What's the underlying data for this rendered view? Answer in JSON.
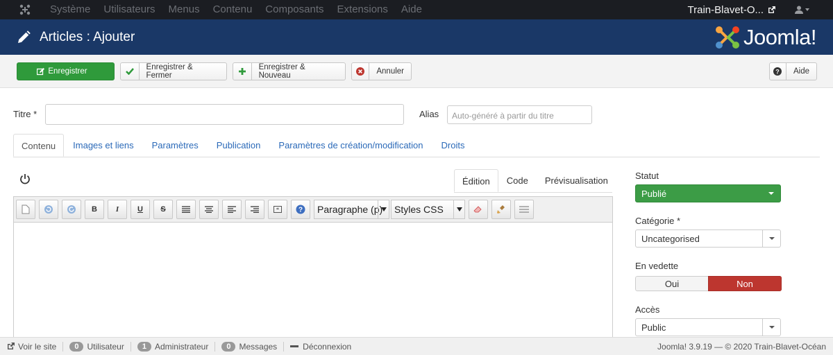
{
  "topnav": {
    "menu": [
      "Système",
      "Utilisateurs",
      "Menus",
      "Contenu",
      "Composants",
      "Extensions",
      "Aide"
    ],
    "site_name": "Train-Blavet-O...",
    "icons": [
      "joomla-icon",
      "external-link-icon",
      "user-icon"
    ]
  },
  "header": {
    "title": "Articles : Ajouter",
    "brand": "Joomla!"
  },
  "toolbar": {
    "save": "Enregistrer",
    "save_close": "Enregistrer & Fermer",
    "save_new": "Enregistrer & Nouveau",
    "cancel": "Annuler",
    "help": "Aide"
  },
  "form": {
    "title_label": "Titre *",
    "title_value": "",
    "alias_label": "Alias",
    "alias_placeholder": "Auto-généré à partir du titre"
  },
  "tabs": [
    "Contenu",
    "Images et liens",
    "Paramètres",
    "Publication",
    "Paramètres de création/modification",
    "Droits"
  ],
  "editor": {
    "tabs": [
      "Édition",
      "Code",
      "Prévisualisation"
    ],
    "format_select": "Paragraphe (p)",
    "styles_select": "Styles CSS",
    "buttons": [
      "new-document-icon",
      "undo-icon",
      "redo-icon",
      "bold-icon",
      "italic-icon",
      "underline-icon",
      "strikethrough-icon",
      "align-justify-icon",
      "align-center-icon",
      "align-left-icon",
      "align-right-icon",
      "blockquote-icon",
      "help-icon",
      "eraser-icon",
      "clean-icon",
      "horizontal-rule-icon"
    ],
    "content": ""
  },
  "sidebar": {
    "status_label": "Statut",
    "status_value": "Publié",
    "category_label": "Catégorie *",
    "category_value": "Uncategorised",
    "featured_label": "En vedette",
    "featured_yes": "Oui",
    "featured_no": "Non",
    "access_label": "Accès",
    "access_value": "Public"
  },
  "statusbar": {
    "view_site": "Voir le site",
    "users_count": "0",
    "users_label": "Utilisateur",
    "admin_count": "1",
    "admin_label": "Administrateur",
    "messages_count": "0",
    "messages_label": "Messages",
    "logout": "Déconnexion",
    "footer": "Joomla! 3.9.19 — © 2020 Train-Blavet-Océan"
  },
  "colors": {
    "navbar": "#1b1d22",
    "header": "#1a3867",
    "success": "#2f9a3b",
    "danger": "#bd362f",
    "link": "#2a69b8"
  }
}
